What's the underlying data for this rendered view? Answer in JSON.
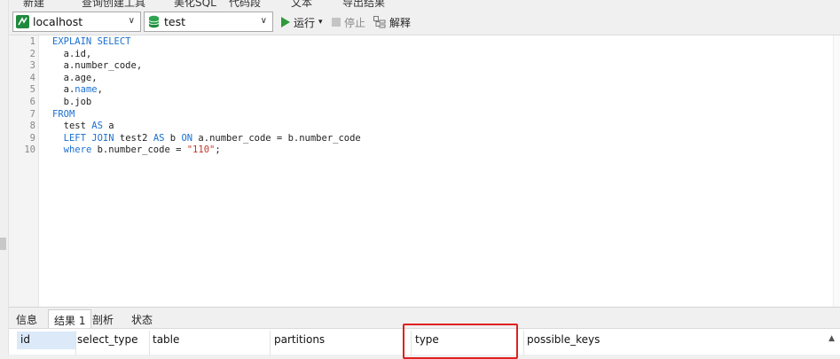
{
  "top_strip": [
    "新建",
    "查询创建工具",
    "美化SQL",
    "代码段",
    "文本",
    "导出结果"
  ],
  "toolbar": {
    "connection": "localhost",
    "database": "test",
    "run_label": "运行",
    "run_arrow": "▾",
    "stop_label": "停止",
    "explain_label": "解释"
  },
  "editor": {
    "lines": [
      {
        "n": "1",
        "parts": [
          [
            "kw",
            "EXPLAIN SELECT"
          ]
        ]
      },
      {
        "n": "2",
        "parts": [
          [
            "",
            "  a.id,"
          ]
        ]
      },
      {
        "n": "3",
        "parts": [
          [
            "",
            "  a.number_code,"
          ]
        ]
      },
      {
        "n": "4",
        "parts": [
          [
            "",
            "  a.age,"
          ]
        ]
      },
      {
        "n": "5",
        "parts": [
          [
            "",
            "  a."
          ],
          [
            "kw",
            "name"
          ],
          [
            "",
            ","
          ]
        ]
      },
      {
        "n": "6",
        "parts": [
          [
            "",
            "  b.job"
          ]
        ]
      },
      {
        "n": "7",
        "parts": [
          [
            "kw",
            "FROM"
          ]
        ]
      },
      {
        "n": "8",
        "parts": [
          [
            "",
            "  test "
          ],
          [
            "kw",
            "AS"
          ],
          [
            "",
            " a"
          ]
        ]
      },
      {
        "n": "9",
        "parts": [
          [
            "",
            "  "
          ],
          [
            "kw",
            "LEFT JOIN"
          ],
          [
            "",
            " test2 "
          ],
          [
            "kw",
            "AS"
          ],
          [
            "",
            " b "
          ],
          [
            "kw",
            "ON"
          ],
          [
            "",
            " a.number_code = b.number_code"
          ]
        ]
      },
      {
        "n": "10",
        "parts": [
          [
            "",
            "  "
          ],
          [
            "kw",
            "where"
          ],
          [
            "",
            " b.number_code = "
          ],
          [
            "str",
            "\"110\""
          ],
          [
            "",
            ";"
          ]
        ]
      }
    ]
  },
  "result_tabs": [
    "信息",
    "结果 1",
    "剖析",
    "状态"
  ],
  "active_tab": "结果 1",
  "grid": {
    "columns": [
      "id",
      "select_type",
      "table",
      "partitions",
      "type",
      "possible_keys"
    ]
  },
  "colors": {
    "keyword": "#1a6fd1",
    "string": "#c0392b",
    "highlight": "#e02020",
    "run": "#2e9a3a"
  }
}
